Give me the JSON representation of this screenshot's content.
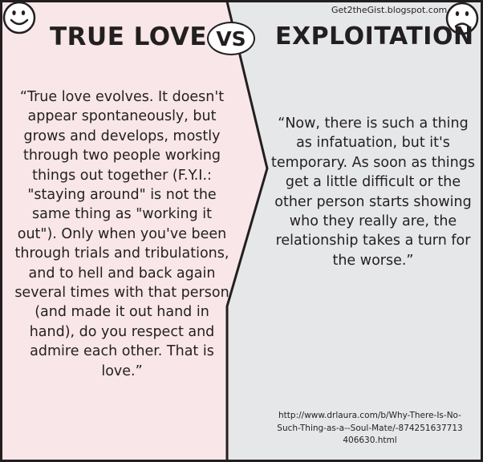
{
  "colors": {
    "left_panel": "#f8e6e8",
    "right_panel": "#e6e7e8",
    "ink": "#231f20"
  },
  "icons": {
    "left": "happy-face-icon",
    "right": "sad-face-icon"
  },
  "header": {
    "left_title": "TRUE LOVE",
    "vs_label": "VS",
    "right_title": "EXPLOITATION",
    "site": "Get2theGist.blogspot.com"
  },
  "left": {
    "quote": "“True love evolves. It doesn't appear spontaneously, but grows and develops, mostly through two people working things out together (F.Y.I.: \"staying around\" is not the same thing as \"working it out\"). Only when you've been through trials and tribulations, and to hell and back again several times with that person (and made it out hand in hand), do you respect and admire each other. That is love.”"
  },
  "right": {
    "quote": "“Now, there is such a thing as infatuation, but it's temporary. As soon as things get a little difficult or the other person starts showing who they really are, the relationship takes a turn for the worse.”",
    "source": "http://www.drlaura.com/b/Why-There-Is-No-Such-Thing-as-a--Soul-Mate/-874251637713406630.html"
  }
}
